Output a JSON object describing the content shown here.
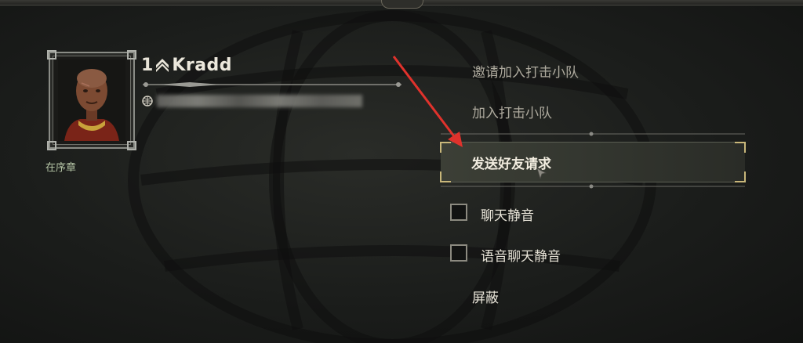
{
  "player": {
    "rank_number": "1",
    "name": "Kradd",
    "chapter": "在序章"
  },
  "menu": {
    "invite_strike": "邀请加入打击小队",
    "join_strike": "加入打击小队",
    "send_friend_request": "发送好友请求",
    "mute_chat": "聊天静音",
    "mute_voice": "语音聊天静音",
    "block": "屏蔽"
  },
  "colors": {
    "highlight_corner": "#c9b77a",
    "annotation_arrow": "#e0322c"
  }
}
